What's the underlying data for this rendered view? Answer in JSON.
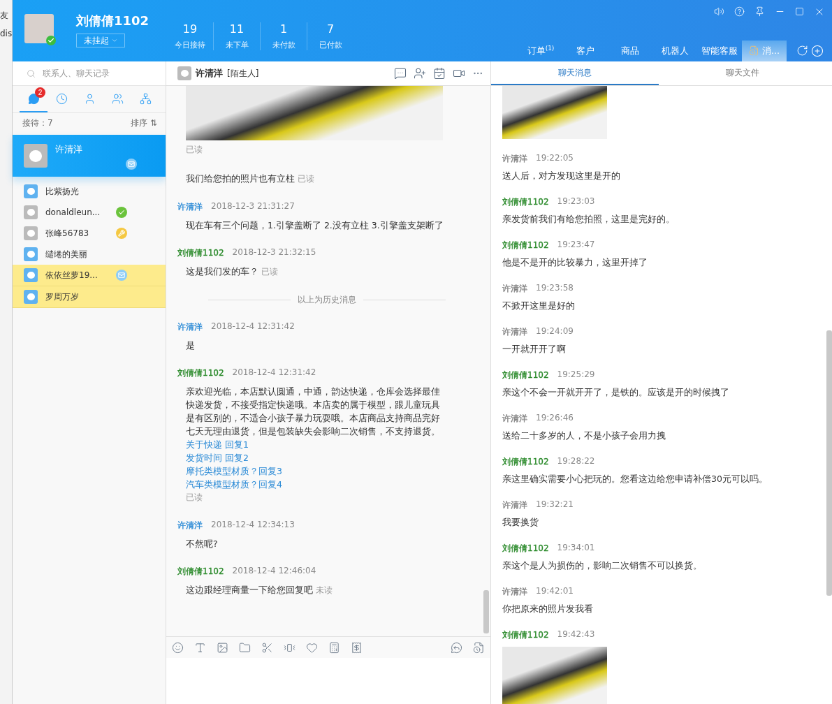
{
  "background_window": {
    "texts": [
      "友",
      "dis"
    ]
  },
  "header": {
    "name": "刘倩倩1102",
    "status": "未挂起",
    "online": true,
    "stats": [
      {
        "value": "19",
        "label": "今日接待"
      },
      {
        "value": "11",
        "label": "未下单"
      },
      {
        "value": "1",
        "label": "未付款"
      },
      {
        "value": "7",
        "label": "已付款"
      }
    ],
    "nav_tabs": [
      {
        "label": "订单$^{(1)}$",
        "selected": false
      },
      {
        "label": "客户",
        "selected": false
      },
      {
        "label": "商品",
        "selected": false
      },
      {
        "label": "机器人",
        "selected": false
      },
      {
        "label": "智能客服",
        "selected": false
      },
      {
        "label": "消...",
        "selected": true
      }
    ]
  },
  "sidebar": {
    "search": {
      "placeholder": "联系人、聊天记录"
    },
    "tabs": [
      {
        "kind": "chat",
        "selected": true,
        "badge": "2"
      },
      {
        "kind": "history",
        "selected": false
      },
      {
        "kind": "contact",
        "selected": false
      },
      {
        "kind": "group",
        "selected": false
      },
      {
        "kind": "org",
        "selected": false
      }
    ],
    "count": "接待：7",
    "sort": "排序 ⇅",
    "contacts": [
      {
        "name": "许清洋",
        "selected": true,
        "highlighted": false,
        "online": false,
        "badge": {
          "kind": "mail"
        }
      },
      {
        "name": "比紫扬光",
        "selected": false,
        "highlighted": false,
        "online": true
      },
      {
        "name": "donaldleun...",
        "selected": false,
        "highlighted": false,
        "online": false,
        "badge": {
          "kind": "check"
        }
      },
      {
        "name": "张峰56783",
        "selected": false,
        "highlighted": false,
        "online": false,
        "badge": {
          "kind": "tool"
        }
      },
      {
        "name": "缱绻的美丽",
        "selected": false,
        "highlighted": false,
        "online": true
      },
      {
        "name": "依依丝萝19...",
        "selected": false,
        "highlighted": true,
        "online": true,
        "badge": {
          "kind": "mail"
        }
      },
      {
        "name": "罗周万岁",
        "selected": false,
        "highlighted": true,
        "online": true
      }
    ]
  },
  "chat": {
    "title": "许清洋",
    "tag": "[陌生人]",
    "messages": [
      {
        "kind": "image",
        "status": "已读"
      },
      {
        "kind": "text",
        "text": "我们给您拍的照片也有立柱",
        "status": "已读"
      },
      {
        "kind": "text",
        "color": "#2a8ad6",
        "sender": "许清洋",
        "time": "2018-12-3 21:31:27",
        "text": "现在车有三个问题，1.引擎盖断了 2.没有立柱 3.引擎盖支架断了"
      },
      {
        "kind": "text",
        "color": "#2b8a2b",
        "sender": "刘倩倩1102",
        "time": "2018-12-3 21:32:15",
        "text": "这是我们发的车？",
        "status": "已读"
      },
      {
        "kind": "divider",
        "text": "以上为历史消息"
      },
      {
        "kind": "text",
        "color": "#2a8ad6",
        "sender": "许清洋",
        "time": "2018-12-4 12:31:42",
        "text": "是"
      },
      {
        "kind": "auto",
        "color": "#2b8a2b",
        "sender": "刘倩倩1102",
        "time": "2018-12-4 12:31:42",
        "text": "亲欢迎光临，本店默认圆通，中通，韵达快递，仓库会选择最佳快递发货，不接受指定快递哦。本店卖的属于模型，跟儿童玩具是有区别的，不适合小孩子暴力玩耍哦。本店商品支持商品完好七天无理由退货，但是包装缺失会影响二次销售，不支持退货。",
        "links": [
          "关于快递 回复1",
          "发货时间 回复2",
          "摩托类模型材质？回复3",
          "汽车类模型材质？回复4"
        ],
        "status": "已读"
      },
      {
        "kind": "text",
        "color": "#2a8ad6",
        "sender": "许清洋",
        "time": "2018-12-4 12:34:13",
        "text": "不然呢?"
      },
      {
        "kind": "text",
        "color": "#2b8a2b",
        "sender": "刘倩倩1102",
        "time": "2018-12-4 12:46:04",
        "text": "这边跟经理商量一下给您回复吧",
        "status": "未读"
      }
    ]
  },
  "history": {
    "tabs": [
      {
        "label": "聊天消息",
        "selected": true
      },
      {
        "label": "聊天文件",
        "selected": false
      }
    ],
    "messages": [
      {
        "kind": "image"
      },
      {
        "kind": "text",
        "color": "#808080",
        "sender": "许清洋",
        "time": "19:22:05",
        "text": "送人后，对方发现这里是开的"
      },
      {
        "kind": "text",
        "color": "#2b8a2b",
        "sender": "刘倩倩1102",
        "time": "19:23:03",
        "text": "亲发货前我们有给您拍照，这里是完好的。"
      },
      {
        "kind": "text",
        "color": "#2b8a2b",
        "sender": "刘倩倩1102",
        "time": "19:23:47",
        "text": "他是不是开的比较暴力，这里开掉了"
      },
      {
        "kind": "text",
        "color": "#808080",
        "sender": "许清洋",
        "time": "19:23:58",
        "text": "不掀开这里是好的"
      },
      {
        "kind": "text",
        "color": "#808080",
        "sender": "许清洋",
        "time": "19:24:09",
        "text": "一开就开开了啊"
      },
      {
        "kind": "text",
        "color": "#2b8a2b",
        "sender": "刘倩倩1102",
        "time": "19:25:29",
        "text": "亲这个不会一开就开开了，是铁的。应该是开的时候拽了"
      },
      {
        "kind": "text",
        "color": "#808080",
        "sender": "许清洋",
        "time": "19:26:46",
        "text": "送给二十多岁的人，不是小孩子会用力拽"
      },
      {
        "kind": "text",
        "color": "#2b8a2b",
        "sender": "刘倩倩1102",
        "time": "19:28:22",
        "text": "亲这里确实需要小心把玩的。您看这边给您申请补偿30元可以吗。"
      },
      {
        "kind": "text",
        "color": "#808080",
        "sender": "许清洋",
        "time": "19:32:21",
        "text": "我要换货"
      },
      {
        "kind": "text",
        "color": "#2b8a2b",
        "sender": "刘倩倩1102",
        "time": "19:34:01",
        "text": "亲这个是人为损伤的，影响二次销售不可以换货。"
      },
      {
        "kind": "text",
        "color": "#808080",
        "sender": "许清洋",
        "time": "19:42:01",
        "text": "你把原来的照片发我看"
      },
      {
        "kind": "image",
        "color": "#2b8a2b",
        "sender": "刘倩倩1102",
        "time": "19:42:43"
      }
    ]
  }
}
